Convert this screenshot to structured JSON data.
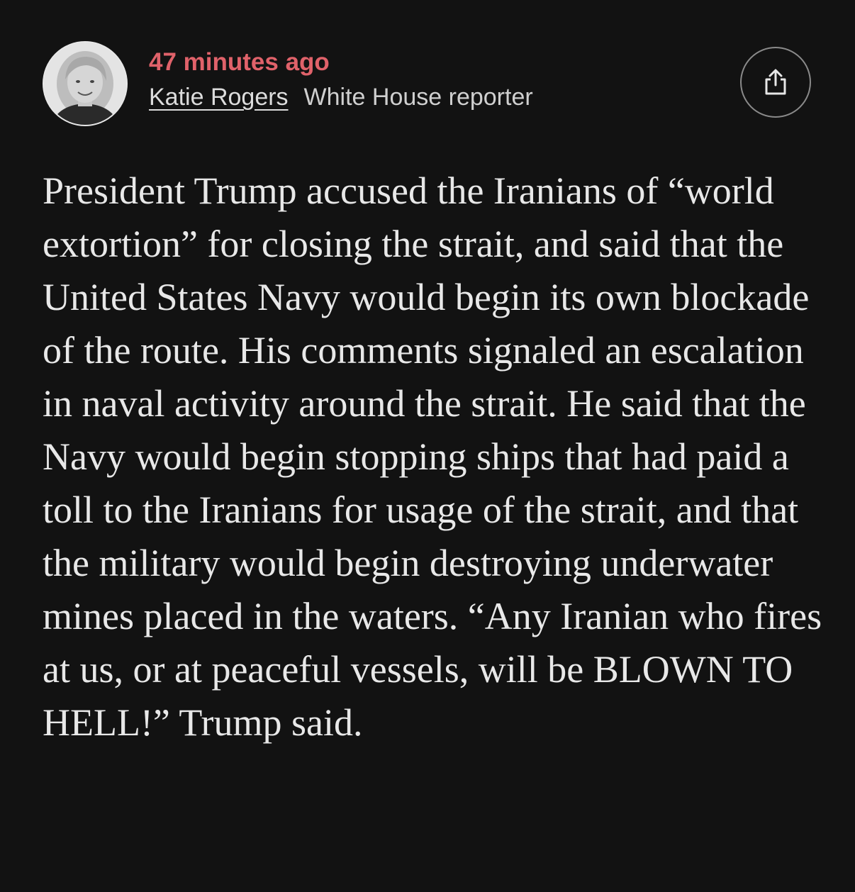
{
  "post": {
    "timestamp": "47 minutes ago",
    "author": {
      "name": "Katie Rogers",
      "role": "White House reporter"
    },
    "icons": {
      "avatar": "author-photo",
      "share": "share-icon"
    },
    "body": "President Trump accused the Iranians of “world extortion” for closing the strait, and said that the United States Navy would begin its own blockade of the route. His comments signaled an escalation in naval activity around the strait. He said that the Navy would begin stopping ships that had paid a toll to the Iranians for usage of the strait, and that the military would begin destroying underwater mines placed in the waters. “Any Iranian who fires at us, or at peaceful vessels, will be BLOWN TO HELL!” Trump said."
  },
  "colors": {
    "background": "#121212",
    "timestamp": "#e0626a",
    "text": "#e8e8e8"
  }
}
